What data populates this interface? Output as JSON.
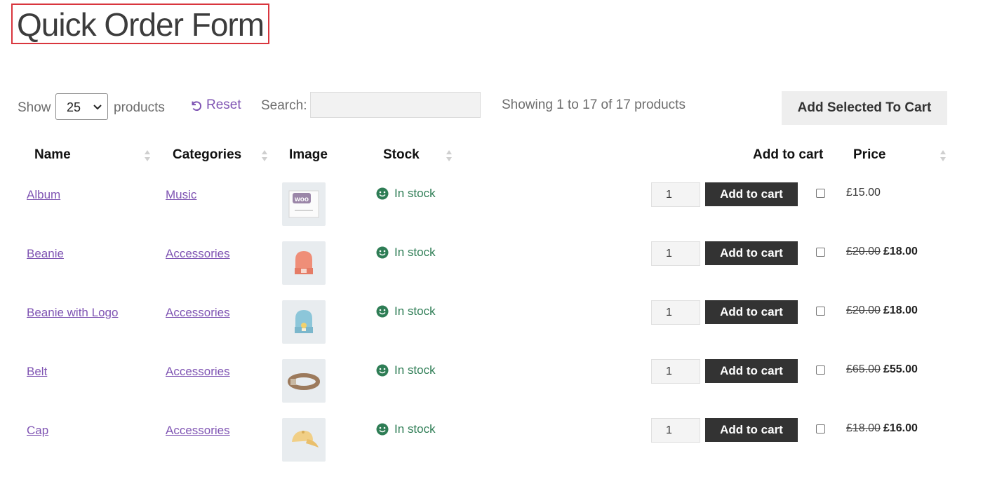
{
  "page": {
    "title": "Quick Order Form"
  },
  "toolbar": {
    "show_label": "Show",
    "page_size": "25",
    "products_label": "products",
    "reset_label": "Reset",
    "search_label": "Search:",
    "search_value": "",
    "info": "Showing 1 to 17 of 17 products",
    "add_selected_label": "Add Selected To Cart"
  },
  "table": {
    "headers": {
      "name": "Name",
      "categories": "Categories",
      "image": "Image",
      "stock": "Stock",
      "add_to_cart": "Add to cart",
      "price": "Price"
    },
    "add_to_cart_label": "Add to cart",
    "rows": [
      {
        "name": "Album",
        "category": "Music",
        "image": "album-thumbnail",
        "stock": "In stock",
        "qty": "1",
        "price_old": "",
        "price": "£15.00"
      },
      {
        "name": "Beanie",
        "category": "Accessories",
        "image": "beanie-thumbnail",
        "stock": "In stock",
        "qty": "1",
        "price_old": "£20.00",
        "price": "£18.00"
      },
      {
        "name": "Beanie with Logo",
        "category": "Accessories",
        "image": "beanie-logo-thumbnail",
        "stock": "In stock",
        "qty": "1",
        "price_old": "£20.00",
        "price": "£18.00"
      },
      {
        "name": "Belt",
        "category": "Accessories",
        "image": "belt-thumbnail",
        "stock": "In stock",
        "qty": "1",
        "price_old": "£65.00",
        "price": "£55.00"
      },
      {
        "name": "Cap",
        "category": "Accessories",
        "image": "cap-thumbnail",
        "stock": "In stock",
        "qty": "1",
        "price_old": "£18.00",
        "price": "£16.00"
      }
    ]
  },
  "colors": {
    "link": "#7f54b3",
    "stock": "#2e7d55",
    "button_dark": "#333333",
    "highlight_border": "#d9363e"
  }
}
